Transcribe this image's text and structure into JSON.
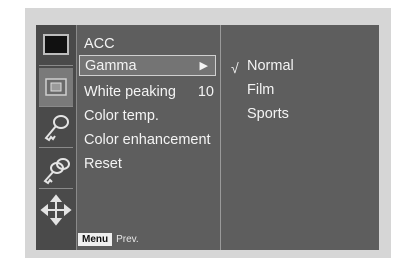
{
  "menu": {
    "items": [
      {
        "label": "ACC",
        "value": ""
      },
      {
        "label": "Gamma",
        "value": ""
      },
      {
        "label": "White peaking",
        "value": "10"
      },
      {
        "label": "Color temp.",
        "value": ""
      },
      {
        "label": "Color enhancement",
        "value": ""
      },
      {
        "label": "Reset",
        "value": ""
      }
    ],
    "selected_arrow": "▶"
  },
  "submenu": {
    "check_mark": "√",
    "options": [
      "Normal",
      "Film",
      "Sports"
    ],
    "selected": "Normal"
  },
  "footer": {
    "menu_key": "Menu",
    "prev_label": "Prev."
  },
  "icons": [
    "screen-icon",
    "picture-icon",
    "key-icon",
    "keys-icon",
    "move-icon"
  ],
  "colors": {
    "panel": "#5e5e5e",
    "highlight": "#747474",
    "frame": "#d6d6d6"
  }
}
